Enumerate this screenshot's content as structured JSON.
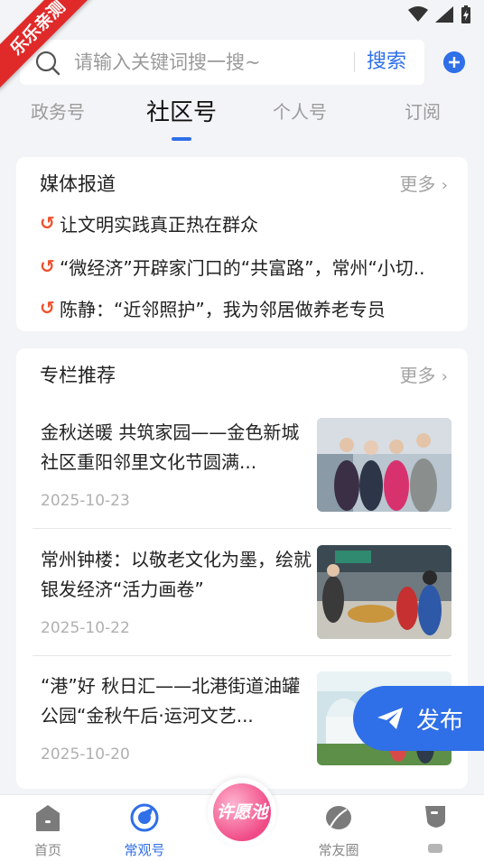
{
  "ribbon": {
    "label": "乐乐亲测"
  },
  "search": {
    "placeholder": "请输入关键词搜一搜~",
    "button_label": "搜索"
  },
  "tabs": [
    {
      "label": "政务号",
      "active": false
    },
    {
      "label": "社区号",
      "active": true
    },
    {
      "label": "个人号",
      "active": false
    },
    {
      "label": "订阅",
      "active": false
    }
  ],
  "media_section": {
    "title": "媒体报道",
    "more_label": "更多",
    "items": [
      {
        "text": "让文明实践真正热在群众"
      },
      {
        "text": "“微经济”开辟家门口的“共富路”，常州“小切.."
      },
      {
        "text": "陈静：“近邻照护”，我为邻居做养老专员"
      }
    ]
  },
  "column_section": {
    "title": "专栏推荐",
    "more_label": "更多",
    "articles": [
      {
        "title": "金秋送暖 共筑家园——金色新城社区重阳邻里文化节圆满...",
        "date": "2025-10-23"
      },
      {
        "title": "常州钟楼：以敬老文化为墨，绘就银发经济“活力画卷”",
        "date": "2025-10-22"
      },
      {
        "title": "“港”好 秋日汇——北港街道油罐公园“金秋午后·运河文艺...",
        "date": "2025-10-20"
      }
    ]
  },
  "publish_button": {
    "label": "发布"
  },
  "bottom_nav": {
    "items": [
      {
        "label": "首页",
        "icon": "home-icon",
        "active": false
      },
      {
        "label": "常观号",
        "icon": "compass-icon",
        "active": true
      },
      {
        "label": "常友圈",
        "icon": "leaf-icon",
        "active": false
      },
      {
        "label": "",
        "icon": "chat-icon",
        "active": false
      }
    ],
    "center_label": "许愿池"
  },
  "colors": {
    "accent": "#2f6fe8",
    "ribbon": "#e02a2a",
    "bullet": "#f0522d",
    "wish": "#f04b86"
  }
}
